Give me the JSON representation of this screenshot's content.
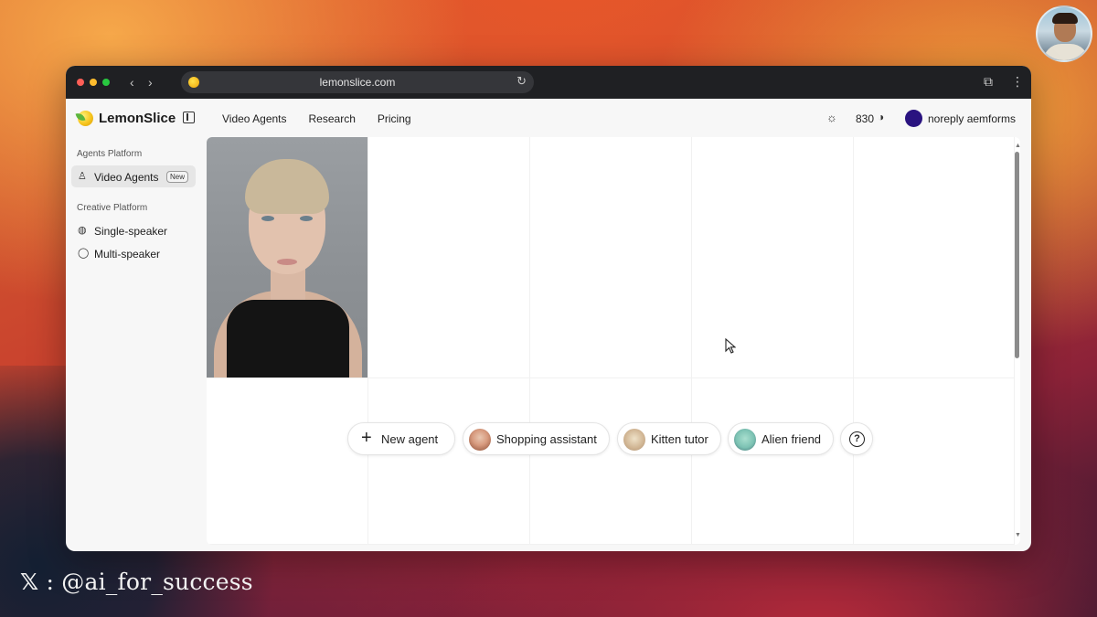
{
  "browser": {
    "url": "lemonslice.com",
    "back_glyph": "‹",
    "forward_glyph": "›",
    "reload_glyph": "↻",
    "extensions_glyph": "⧉",
    "menu_glyph": "⋮"
  },
  "header": {
    "brand": "LemonSlice",
    "nav": [
      "Video Agents",
      "Research",
      "Pricing"
    ],
    "theme_glyph": "☼",
    "credits": "830",
    "credits_glyph": "◑",
    "user_name": "noreply aemforms",
    "user_color": "#2a1380"
  },
  "sidebar": {
    "sections": [
      {
        "label": "Agents Platform",
        "items": [
          {
            "label": "Video Agents",
            "icon": "person-icon",
            "glyph": "♙",
            "badge": "New",
            "active": true
          }
        ]
      },
      {
        "label": "Creative Platform",
        "items": [
          {
            "label": "Single-speaker",
            "icon": "palette-icon",
            "glyph": "◍"
          },
          {
            "label": "Multi-speaker",
            "icon": "chat-bubble-icon",
            "glyph": "◯"
          }
        ]
      }
    ]
  },
  "actions": {
    "new_agent": "New agent",
    "plus_glyph": "+",
    "presets": [
      "Shopping assistant",
      "Kitten tutor",
      "Alien friend"
    ],
    "help_glyph": "?"
  },
  "overlay": {
    "watermark_icon": "𝕏",
    "watermark": ": @ai_for_success"
  },
  "colors": {
    "accent": "#f6c51d",
    "window_bg": "#f7f7f7",
    "titlebar": "#1f2023"
  }
}
